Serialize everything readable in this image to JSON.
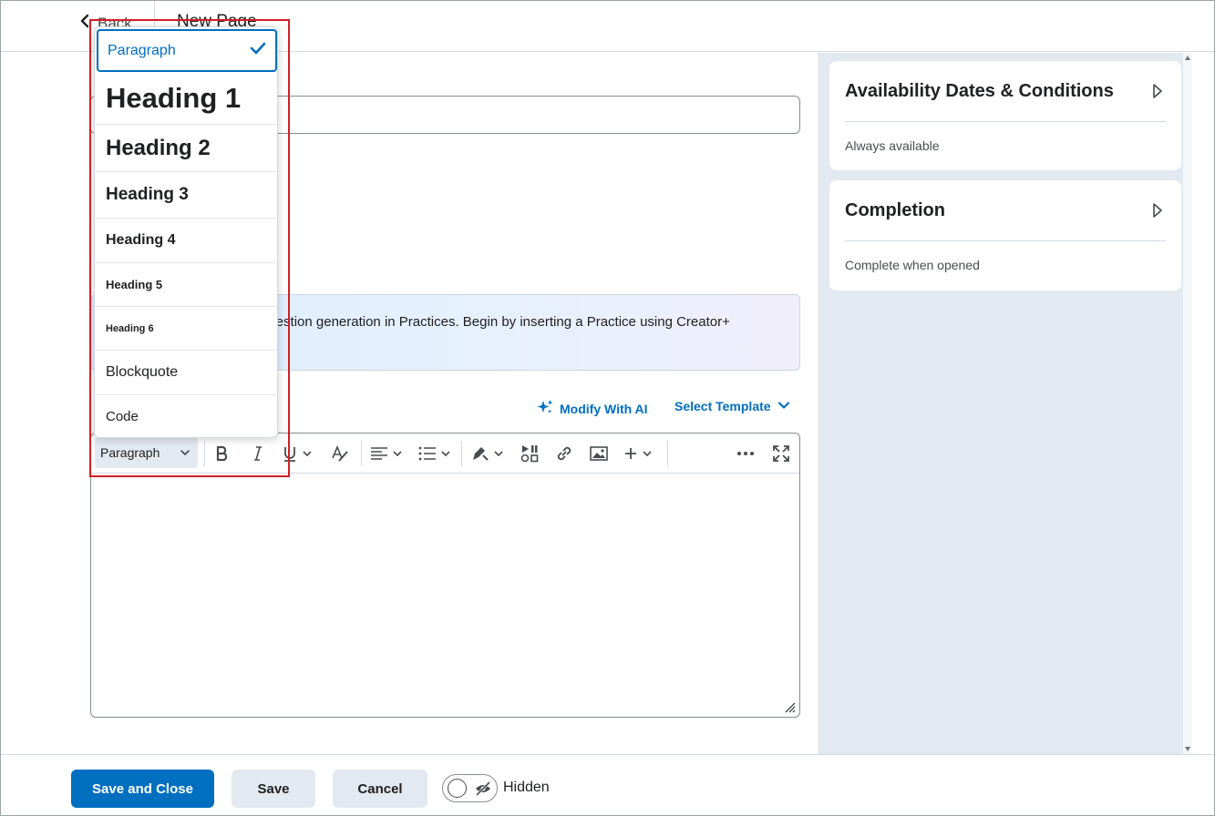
{
  "topbar": {
    "back_label": "Back",
    "page_title": "New Page"
  },
  "main": {
    "ai_banner_text": "question generation in Practices. Begin by inserting a Practice using Creator+",
    "modify_ai_label": "Modify With AI",
    "select_template_label": "Select Template"
  },
  "editor": {
    "format_value": "Paragraph"
  },
  "format_menu": {
    "items": [
      {
        "label": "Paragraph",
        "selected": true
      },
      {
        "label": "Heading 1"
      },
      {
        "label": "Heading 2"
      },
      {
        "label": "Heading 3"
      },
      {
        "label": "Heading 4"
      },
      {
        "label": "Heading 5"
      },
      {
        "label": "Heading 6"
      },
      {
        "label": "Blockquote"
      },
      {
        "label": "Code"
      }
    ]
  },
  "side_panel": {
    "availability": {
      "title": "Availability Dates & Conditions",
      "value": "Always available"
    },
    "completion": {
      "title": "Completion",
      "value": "Complete when opened"
    }
  },
  "footer": {
    "save_close_label": "Save and Close",
    "save_label": "Save",
    "cancel_label": "Cancel",
    "visibility_label": "Hidden"
  },
  "colors": {
    "accent": "#006fbf",
    "highlight": "#cd2026",
    "panel_bg": "#e3e9f1"
  }
}
